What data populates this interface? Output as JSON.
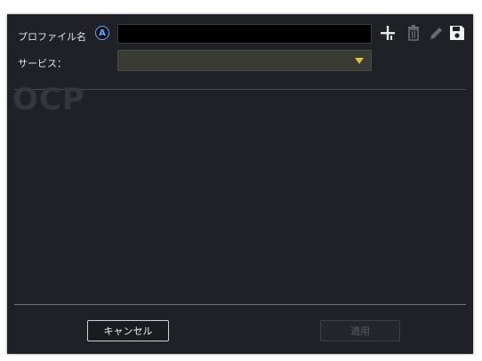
{
  "profile": {
    "label": "プロファイル名",
    "info_glyph": "A",
    "name_value": "",
    "name_placeholder": ""
  },
  "service": {
    "label": "サービス：",
    "selected_value": ""
  },
  "toolbar": {
    "icons": [
      "add-icon",
      "delete-icon",
      "edit-icon",
      "save-icon"
    ]
  },
  "watermark": {
    "text": "OCP"
  },
  "footer": {
    "cancel_label": "キャンセル",
    "apply_label": "適用"
  },
  "colors": {
    "dialog_bg": "#1f2126",
    "accent_arrow": "#d9c23a",
    "info_icon": "#6aa6ff"
  }
}
